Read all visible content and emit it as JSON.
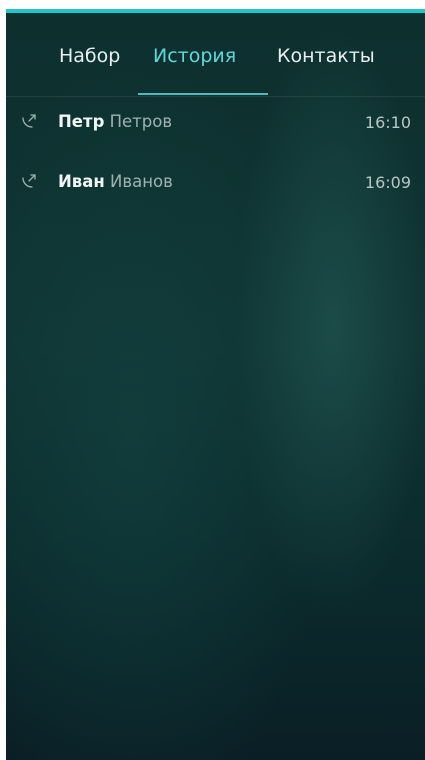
{
  "colors": {
    "accent": "#1fc8c4",
    "active_tab": "#5fd8da",
    "background_top": "#0d302f",
    "background_bottom": "#0a1f25"
  },
  "tabs": [
    {
      "label": "Набор",
      "active": false
    },
    {
      "label": "История",
      "active": true
    },
    {
      "label": "Контакты",
      "active": false
    }
  ],
  "calls": [
    {
      "first_name": "Петр",
      "last_name": "Петров",
      "time": "16:10",
      "icon": "outgoing-call-icon"
    },
    {
      "first_name": "Иван",
      "last_name": "Иванов",
      "time": "16:09",
      "icon": "outgoing-call-icon"
    }
  ]
}
